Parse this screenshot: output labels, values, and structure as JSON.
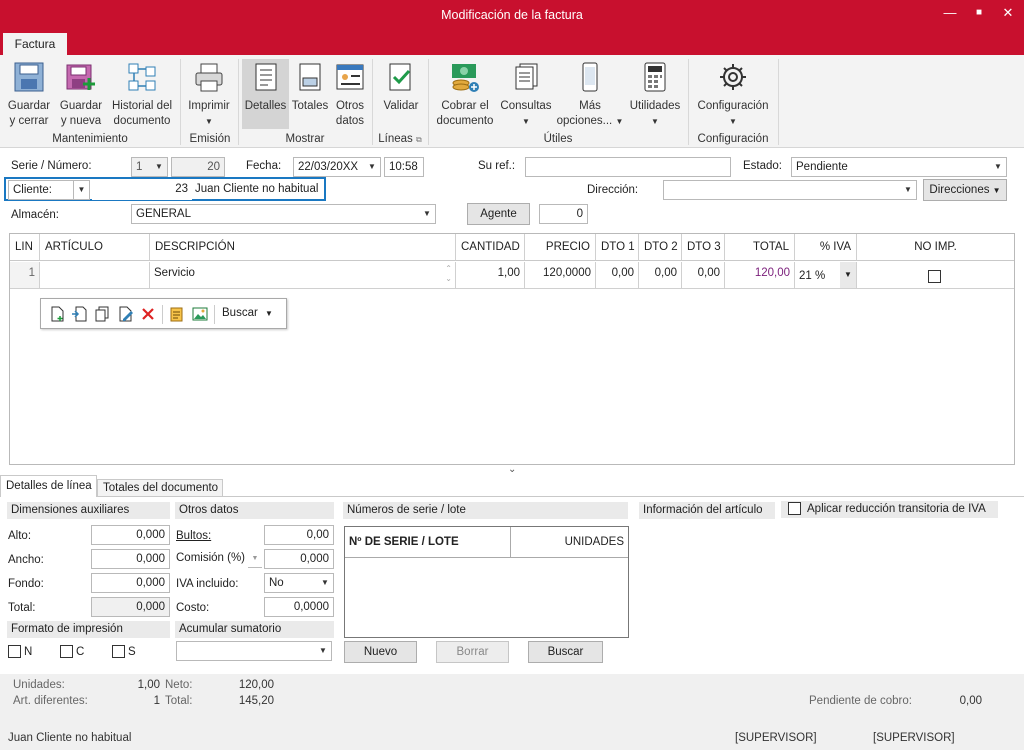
{
  "window": {
    "title": "Modificación de la factura",
    "minimize": "—",
    "maximize": "■",
    "close": "✕"
  },
  "ribbon": {
    "tab": "Factura",
    "buttons": {
      "guardar_cerrar": [
        "Guardar",
        "y cerrar"
      ],
      "guardar_nueva": [
        "Guardar",
        "y nueva"
      ],
      "historial": [
        "Historial del",
        "documento"
      ],
      "imprimir": "Imprimir",
      "detalles": "Detalles",
      "totales": "Totales",
      "otros_datos": [
        "Otros",
        "datos"
      ],
      "validar": "Validar",
      "cobrar": [
        "Cobrar el",
        "documento"
      ],
      "consultas": "Consultas",
      "mas_opciones": [
        "Más",
        "opciones..."
      ],
      "utilidades": "Utilidades",
      "configuracion": "Configuración"
    },
    "groups": {
      "mantenimiento": "Mantenimiento",
      "emision": "Emisión",
      "mostrar": "Mostrar",
      "lineas": "Líneas",
      "utiles": "Útiles",
      "configuracion": "Configuración"
    }
  },
  "header": {
    "serie_label": "Serie / Número:",
    "serie": "1",
    "numero": "20",
    "fecha_label": "Fecha:",
    "fecha": "22/03/20XX",
    "hora": "10:58",
    "suref_label": "Su ref.:",
    "suref": "",
    "estado_label": "Estado:",
    "estado": "Pendiente",
    "cliente_label": "Cliente:",
    "cliente_num": "23",
    "cliente_nombre": "Juan Cliente no habitual",
    "direccion_label": "Dirección:",
    "direccion": "",
    "direcciones_button": "Direcciones",
    "almacen_label": "Almacén:",
    "almacen": "GENERAL",
    "agente_button": "Agente",
    "agente": "0"
  },
  "grid": {
    "columns": [
      "LIN",
      "ARTÍCULO",
      "DESCRIPCIÓN",
      "CANTIDAD",
      "PRECIO",
      "DTO 1",
      "DTO 2",
      "DTO 3",
      "TOTAL",
      "% IVA",
      "NO IMP."
    ],
    "row": {
      "lin": "1",
      "articulo": "",
      "descripcion": "Servicio",
      "cantidad": "1,00",
      "precio": "120,0000",
      "dto1": "0,00",
      "dto2": "0,00",
      "dto3": "0,00",
      "total": "120,00",
      "iva": "21 %"
    },
    "toolbar_search": "Buscar"
  },
  "bottom_tabs": [
    "Detalles de línea",
    "Totales del documento"
  ],
  "dimensiones": {
    "title": "Dimensiones auxiliares",
    "alto_label": "Alto:",
    "alto": "0,000",
    "ancho_label": "Ancho:",
    "ancho": "0,000",
    "fondo_label": "Fondo:",
    "fondo": "0,000",
    "total_label": "Total:",
    "total": "0,000"
  },
  "otros": {
    "title": "Otros datos",
    "bultos_label": "Bultos:",
    "bultos": "0,00",
    "comision_label": "Comisión (%)",
    "comision": "0,000",
    "iva_incl_label": "IVA incluido:",
    "iva_incl": "No",
    "costo_label": "Costo:",
    "costo": "0,0000"
  },
  "formato": {
    "title": "Formato de impresión",
    "n": "N",
    "c": "C",
    "s": "S"
  },
  "acumular": {
    "title": "Acumular sumatorio"
  },
  "series": {
    "title": "Números de serie / lote",
    "col1": "Nº DE SERIE / LOTE",
    "col2": "UNIDADES",
    "nuevo": "Nuevo",
    "borrar": "Borrar",
    "buscar": "Buscar"
  },
  "info": {
    "title": "Información del artículo",
    "reduccion": "Aplicar reducción transitoria de IVA"
  },
  "footer": {
    "unidades_label": "Unidades:",
    "unidades": "1,00",
    "art_label": "Art. diferentes:",
    "art": "1",
    "neto_label": "Neto:",
    "neto": "120,00",
    "total_label": "Total:",
    "total": "145,20",
    "pendiente_label": "Pendiente de cobro:",
    "pendiente": "0,00"
  },
  "status": {
    "cliente": "Juan Cliente no habitual",
    "user1": "[SUPERVISOR]",
    "user2": "[SUPERVISOR]"
  },
  "colors": {
    "accent": "#c8102e",
    "focus": "#1a78c2",
    "total_value": "#7b1f7b"
  }
}
